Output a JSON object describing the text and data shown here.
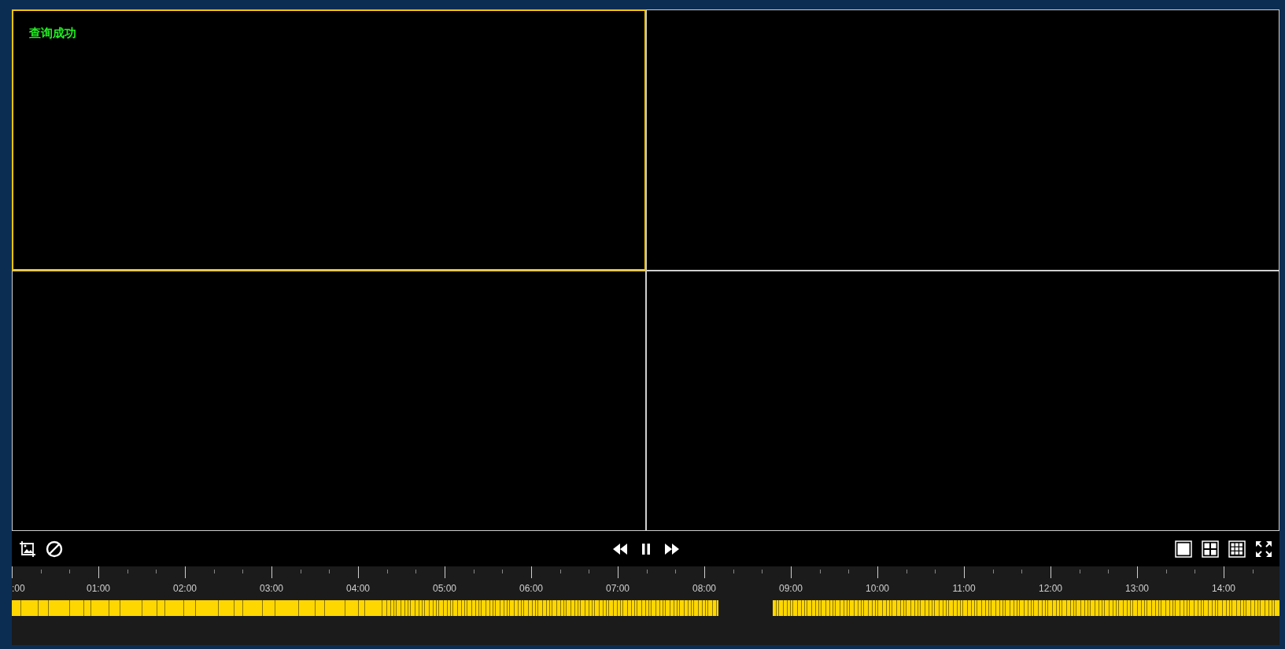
{
  "cells": [
    {
      "selected": true,
      "status": "查询成功"
    },
    {
      "selected": false
    },
    {
      "selected": false
    },
    {
      "selected": false
    }
  ],
  "timeline": {
    "labels": [
      ":00",
      "01:00",
      "02:00",
      "03:00",
      "04:00",
      "05:00",
      "06:00",
      "07:00",
      "08:00",
      "09:00",
      "10:00",
      "11:00",
      "12:00",
      "13:00",
      "14:00"
    ]
  }
}
